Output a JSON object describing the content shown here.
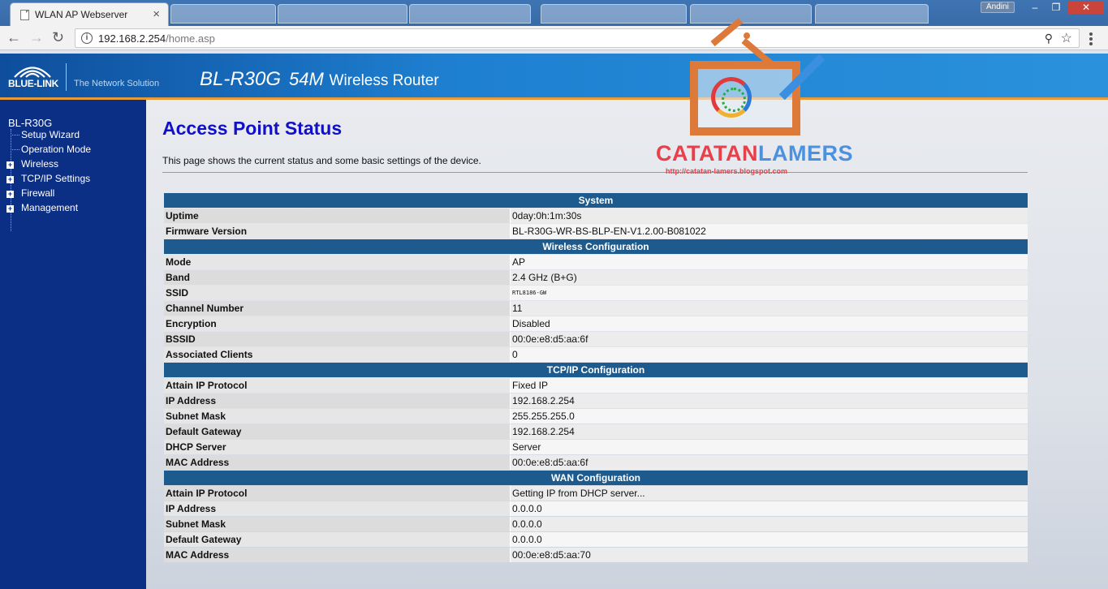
{
  "browser": {
    "tab_title": "WLAN AP Webserver",
    "tab_close": "×",
    "user": "Andini",
    "url_host": "192.168.2.254",
    "url_path": "/home.asp"
  },
  "header": {
    "logo": "BLUE-LINK",
    "slogan": "The Network Solution",
    "model": "BL-R30G",
    "speed": "54M",
    "description": "Wireless Router"
  },
  "sidebar": {
    "root": "BL-R30G",
    "items": [
      {
        "label": "Setup Wizard",
        "expandable": false
      },
      {
        "label": "Operation Mode",
        "expandable": false
      },
      {
        "label": "Wireless",
        "expandable": true
      },
      {
        "label": "TCP/IP Settings",
        "expandable": true
      },
      {
        "label": "Firewall",
        "expandable": true
      },
      {
        "label": "Management",
        "expandable": true
      }
    ]
  },
  "main": {
    "title": "Access Point Status",
    "description": "This page shows the current status and some basic settings of the device."
  },
  "sections": [
    {
      "title": "System",
      "rows": [
        {
          "label": "Uptime",
          "value": "0day:0h:1m:30s"
        },
        {
          "label": "Firmware Version",
          "value": "BL-R30G-WR-BS-BLP-EN-V1.2.00-B081022"
        }
      ]
    },
    {
      "title": "Wireless Configuration",
      "rows": [
        {
          "label": "Mode",
          "value": "AP"
        },
        {
          "label": "Band",
          "value": "2.4 GHz (B+G)"
        },
        {
          "label": "SSID",
          "value": "RTL8186-GW",
          "mono": true
        },
        {
          "label": "Channel Number",
          "value": "11"
        },
        {
          "label": "Encryption",
          "value": "Disabled"
        },
        {
          "label": "BSSID",
          "value": "00:0e:e8:d5:aa:6f"
        },
        {
          "label": "Associated Clients",
          "value": "0"
        }
      ]
    },
    {
      "title": "TCP/IP Configuration",
      "rows": [
        {
          "label": "Attain IP Protocol",
          "value": "Fixed IP"
        },
        {
          "label": "IP Address",
          "value": "192.168.2.254"
        },
        {
          "label": "Subnet Mask",
          "value": "255.255.255.0"
        },
        {
          "label": "Default Gateway",
          "value": "192.168.2.254"
        },
        {
          "label": "DHCP Server",
          "value": "Server"
        },
        {
          "label": "MAC Address",
          "value": "00:0e:e8:d5:aa:6f"
        }
      ]
    },
    {
      "title": "WAN Configuration",
      "rows": [
        {
          "label": "Attain IP Protocol",
          "value": "Getting IP from DHCP server..."
        },
        {
          "label": "IP Address",
          "value": "0.0.0.0"
        },
        {
          "label": "Subnet Mask",
          "value": "0.0.0.0"
        },
        {
          "label": "Default Gateway",
          "value": "0.0.0.0"
        },
        {
          "label": "MAC Address",
          "value": "00:0e:e8:d5:aa:70"
        }
      ]
    }
  ],
  "watermark": {
    "part1": "CATATAN",
    "part2": "LAMERS",
    "url": "http://catatan-lamers.blogspot.com"
  },
  "icons": [
    "back-icon",
    "forward-icon",
    "reload-icon",
    "info-icon",
    "pin-icon",
    "star-icon",
    "menu-icon",
    "plus-icon"
  ]
}
